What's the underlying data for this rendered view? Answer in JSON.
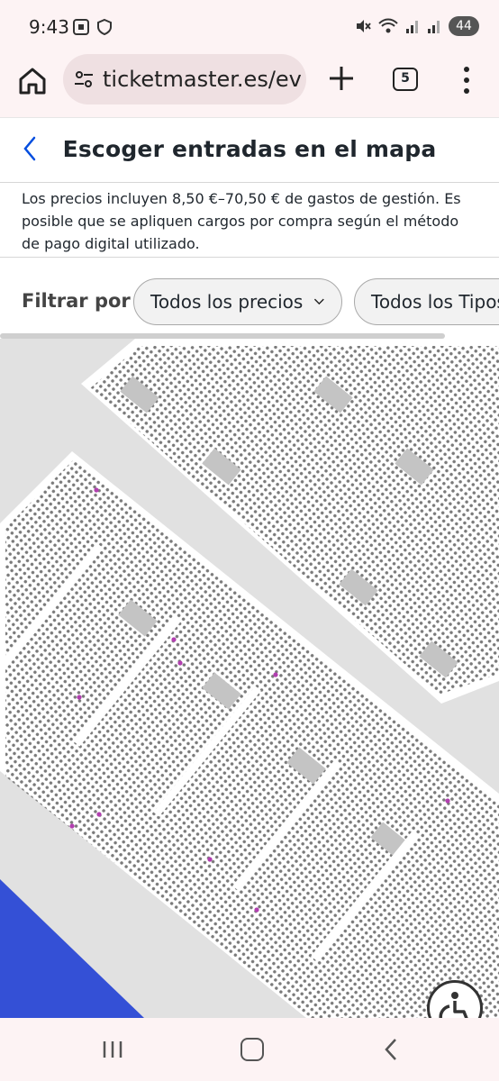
{
  "status_bar": {
    "time": "9:43",
    "battery": "44",
    "icons": [
      "screenshot-icon",
      "shield-icon",
      "mute-icon",
      "wifi-icon",
      "signal-icon",
      "signal-icon"
    ]
  },
  "browser": {
    "url": "ticketmaster.es/ev",
    "tab_count": "5"
  },
  "header": {
    "title": "Escoger entradas en el mapa"
  },
  "notice": {
    "text": "Los precios incluyen 8,50 €–70,50 € de gastos de gestión. Es posible que se apliquen cargos por compra según el método de pago digital utilizado."
  },
  "filters": {
    "label": "Filtrar por",
    "price_chip": "Todos los precios",
    "type_chip": "Todos los Tipos"
  },
  "colors": {
    "seat": "#777777",
    "available_seat": "#b23fb0",
    "stage": "#3450d6",
    "background": "#e1e1e1",
    "block": "#ffffff",
    "aisle": "#c4c4c4"
  }
}
